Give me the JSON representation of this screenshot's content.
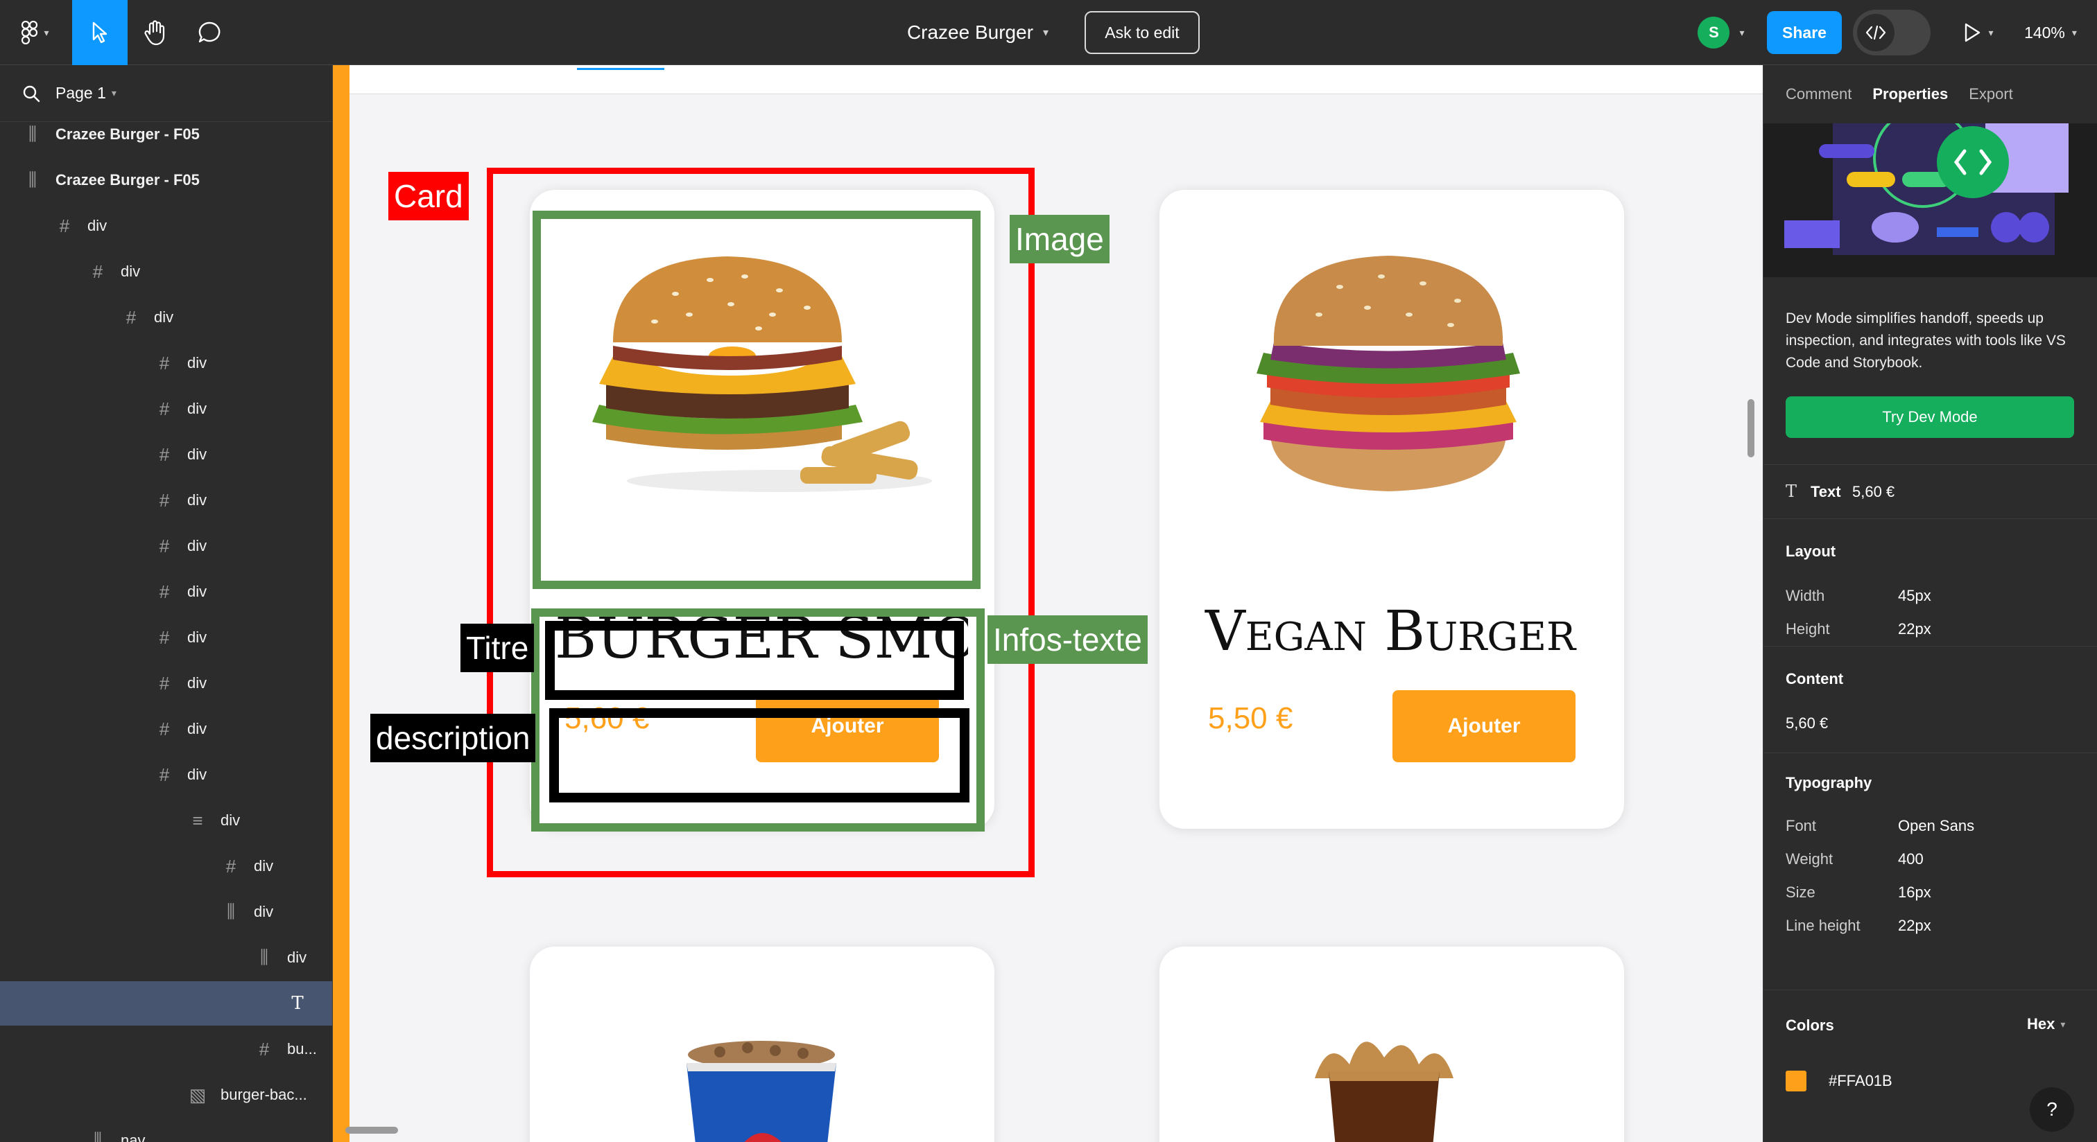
{
  "topbar": {
    "file_title": "Crazee Burger",
    "ask_edit": "Ask to edit",
    "avatar_initial": "S",
    "share": "Share",
    "zoom": "140%"
  },
  "left_panel": {
    "page": "Page 1",
    "layers": [
      {
        "label": "Crazee Burger - F05",
        "icon": "frame-icon"
      },
      {
        "label": "Crazee Burger - F05",
        "icon": "frame-icon"
      },
      {
        "label": "div",
        "icon": "hash-icon"
      },
      {
        "label": "div",
        "icon": "hash-icon"
      },
      {
        "label": "div",
        "icon": "hash-icon"
      },
      {
        "label": "div",
        "icon": "hash-icon"
      },
      {
        "label": "div",
        "icon": "hash-icon"
      },
      {
        "label": "div",
        "icon": "hash-icon"
      },
      {
        "label": "div",
        "icon": "hash-icon"
      },
      {
        "label": "div",
        "icon": "hash-icon"
      },
      {
        "label": "div",
        "icon": "hash-icon"
      },
      {
        "label": "div",
        "icon": "hash-icon"
      },
      {
        "label": "div",
        "icon": "hash-icon"
      },
      {
        "label": "div",
        "icon": "hash-icon"
      },
      {
        "label": "div",
        "icon": "hash-icon"
      },
      {
        "label": "div",
        "icon": "rows-icon"
      },
      {
        "label": "div",
        "icon": "hash-icon"
      },
      {
        "label": "div",
        "icon": "columns-icon"
      },
      {
        "label": "div",
        "icon": "columns-icon"
      },
      {
        "label": "",
        "icon": "text-icon"
      },
      {
        "label": "bu...",
        "icon": "hash-icon"
      },
      {
        "label": "burger-bac...",
        "icon": "image-icon"
      },
      {
        "label": "nav",
        "icon": "columns-icon"
      }
    ]
  },
  "canvas": {
    "cards": [
      {
        "title": "BURGER SMOKE BBQ",
        "price": "5,60 €",
        "button": "Ajouter"
      },
      {
        "title": "Vegan Burger",
        "price": "5,50 €",
        "button": "Ajouter"
      }
    ],
    "annotations": {
      "card": "Card",
      "image": "Image",
      "titre": "Titre",
      "infos": "Infos-texte",
      "description": "description"
    }
  },
  "right_panel": {
    "tabs": [
      "Comment",
      "Properties",
      "Export"
    ],
    "promo_text": "Dev Mode simplifies handoff, speeds up inspection, and integrates with tools like VS Code and Storybook.",
    "try_dev": "Try Dev Mode",
    "selection_type": "Text",
    "selection_value": "5,60 €",
    "layout_title": "Layout",
    "width_label": "Width",
    "width_value": "45px",
    "height_label": "Height",
    "height_value": "22px",
    "content_title": "Content",
    "content_value": "5,60 €",
    "typo_title": "Typography",
    "font_label": "Font",
    "font_value": "Open Sans",
    "weight_label": "Weight",
    "weight_value": "400",
    "size_label": "Size",
    "size_value": "16px",
    "lh_label": "Line height",
    "lh_value": "22px",
    "colors_title": "Colors",
    "colors_format": "Hex",
    "color_value": "#FFA01B",
    "help": "?"
  },
  "colors": {
    "accent_orange": "#ffa01b",
    "figma_blue": "#0d99ff",
    "dev_green": "#14ae5c",
    "annotation_red": "#ff0000",
    "annotation_green": "#5b9650"
  }
}
